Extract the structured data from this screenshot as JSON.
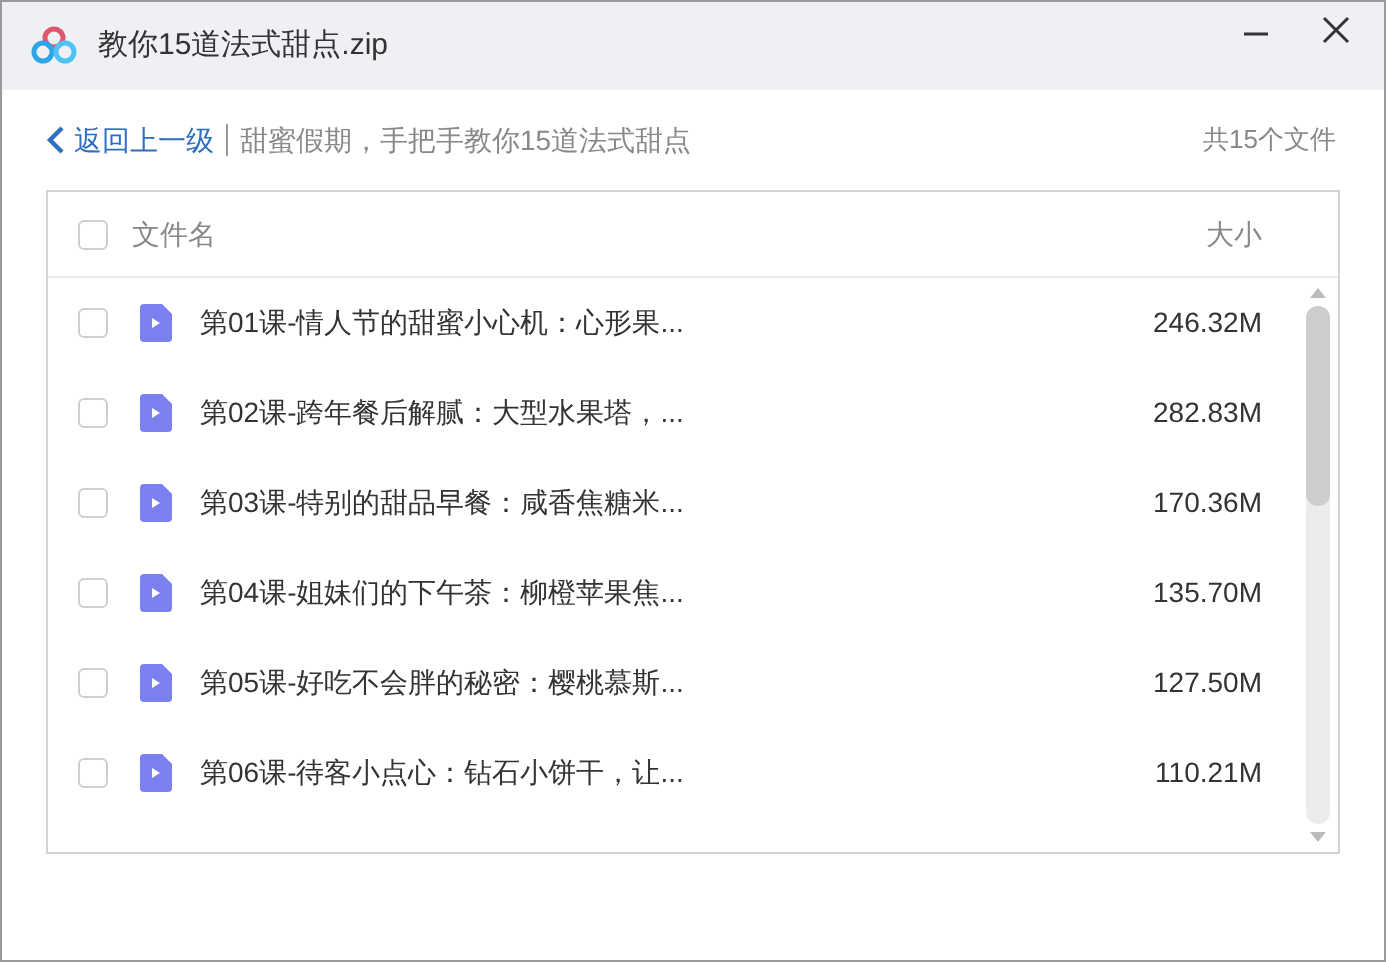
{
  "window": {
    "title": "教你15道法式甜点.zip"
  },
  "nav": {
    "back": "返回上一级",
    "path": "甜蜜假期，手把手教你15道法式甜点",
    "count": "共15个文件"
  },
  "table": {
    "header": {
      "checked": false,
      "name": "文件名",
      "size": "大小"
    },
    "rows": [
      {
        "checked": false,
        "name": "第01课-情人节的甜蜜小心机：心形果...",
        "size": "246.32M"
      },
      {
        "checked": false,
        "name": "第02课-跨年餐后解腻：大型水果塔，...",
        "size": "282.83M"
      },
      {
        "checked": false,
        "name": "第03课-特别的甜品早餐：咸香焦糖米...",
        "size": "170.36M"
      },
      {
        "checked": false,
        "name": "第04课-姐妹们的下午茶：柳橙苹果焦...",
        "size": "135.70M"
      },
      {
        "checked": false,
        "name": "第05课-好吃不会胖的秘密：樱桃慕斯...",
        "size": "127.50M"
      },
      {
        "checked": false,
        "name": "第06课-待客小点心：钻石小饼干，让...",
        "size": "110.21M"
      }
    ]
  }
}
